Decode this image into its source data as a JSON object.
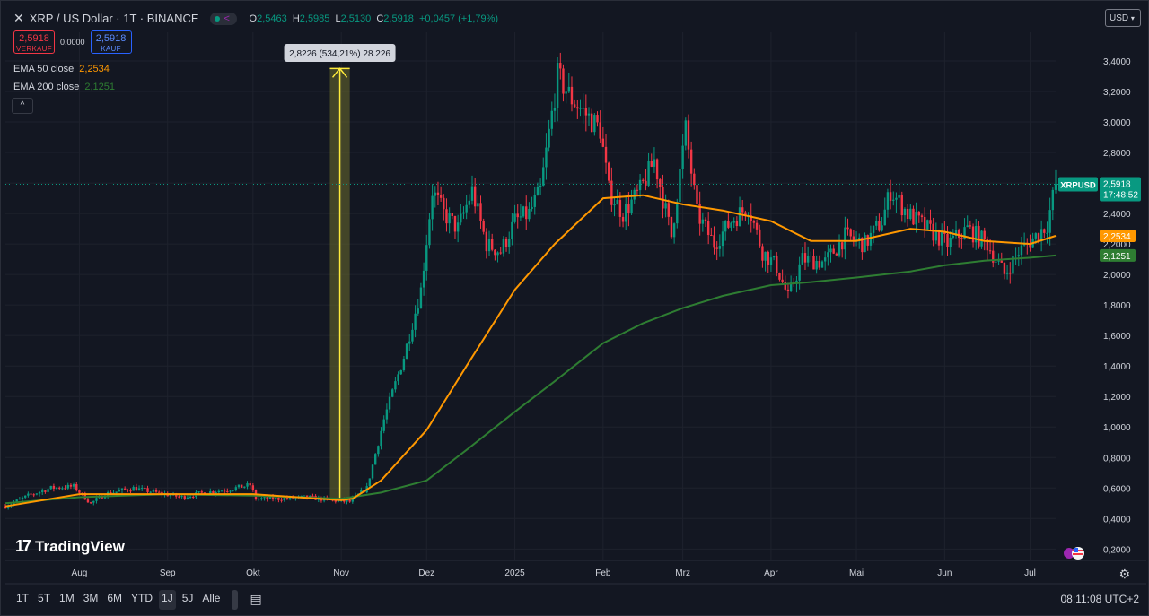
{
  "header": {
    "close_glyph": "✕",
    "title": "XRP / US Dollar · 1T · BINANCE",
    "ohlc": [
      {
        "key": "O",
        "value": "2,5463"
      },
      {
        "key": "H",
        "value": "2,5985"
      },
      {
        "key": "L",
        "value": "2,5130"
      },
      {
        "key": "C",
        "value": "2,5918"
      }
    ],
    "change": "+0,0457 (+1,79%)",
    "status_icons": [
      "live-dot-icon",
      "share-icon"
    ]
  },
  "trade": {
    "sell_price": "2,5918",
    "sell_label": "VERKAUF",
    "spread": "0,0000",
    "buy_price": "2,5918",
    "buy_label": "KAUF"
  },
  "indicators": [
    {
      "label": "EMA 50 close",
      "value": "2,2534",
      "color": "#ff9800"
    },
    {
      "label": "EMA 200 close",
      "value": "2,1251",
      "color": "#2e7d32"
    }
  ],
  "collapse_glyph": "^",
  "currency_button": "USD",
  "logo_text": "TradingView",
  "timeframes": [
    "1T",
    "5T",
    "1M",
    "3M",
    "6M",
    "YTD",
    "1J",
    "5J",
    "Alle"
  ],
  "active_timeframe": "1J",
  "clock": "08:11:08 UTC+2",
  "colors": {
    "up": "#089981",
    "down": "#f23645",
    "ema50": "#ff9800",
    "ema200": "#2e7d32",
    "background": "#131722"
  },
  "chart_data": {
    "type": "candlestick",
    "symbol": "XRPUSD",
    "y_ticks": [
      "3,4000",
      "3,2000",
      "3,0000",
      "2,8000",
      "2,6000",
      "2,4000",
      "2,2000",
      "2,0000",
      "1,8000",
      "1,6000",
      "1,4000",
      "1,2000",
      "1,0000",
      "0,8000",
      "0,6000",
      "0,4000",
      "0,2000"
    ],
    "y_tick_values": [
      3.4,
      3.2,
      3.0,
      2.8,
      2.6,
      2.4,
      2.2,
      2.0,
      1.8,
      1.6,
      1.4,
      1.2,
      1.0,
      0.8,
      0.6,
      0.4,
      0.2
    ],
    "ylim": [
      0.2,
      3.4
    ],
    "x_ticks": [
      "Aug",
      "Sep",
      "Okt",
      "Nov",
      "Dez",
      "2025",
      "Feb",
      "Mrz",
      "Apr",
      "Mai",
      "Jun",
      "Jul"
    ],
    "x_tick_dates": [
      "2024-08-01",
      "2024-09-01",
      "2024-10-01",
      "2024-11-01",
      "2024-12-01",
      "2025-01-01",
      "2025-02-01",
      "2025-03-01",
      "2025-04-01",
      "2025-05-01",
      "2025-06-01",
      "2025-07-01"
    ],
    "last_price": {
      "label": "XRPUSD",
      "value": "2,5918",
      "countdown": "17:48:52",
      "num": 2.5918
    },
    "ema50_tag": {
      "value": "2,2534",
      "num": 2.2534
    },
    "ema200_tag": {
      "value": "2,1251",
      "num": 2.1251
    },
    "range_annotation": {
      "text": "2,8226 (534,21%) 28.226",
      "from_date": "2024-10-28",
      "to_date": "2024-11-04",
      "low": 0.5284,
      "high": 3.351
    },
    "close_series": [
      [
        "2024-07-06",
        0.48
      ],
      [
        "2024-07-14",
        0.55
      ],
      [
        "2024-07-22",
        0.6
      ],
      [
        "2024-07-30",
        0.61
      ],
      [
        "2024-08-05",
        0.5
      ],
      [
        "2024-08-10",
        0.56
      ],
      [
        "2024-08-20",
        0.6
      ],
      [
        "2024-08-28",
        0.57
      ],
      [
        "2024-09-06",
        0.54
      ],
      [
        "2024-09-14",
        0.57
      ],
      [
        "2024-09-22",
        0.59
      ],
      [
        "2024-09-30",
        0.62
      ],
      [
        "2024-10-02",
        0.53
      ],
      [
        "2024-10-10",
        0.53
      ],
      [
        "2024-10-20",
        0.54
      ],
      [
        "2024-10-28",
        0.52
      ],
      [
        "2024-11-04",
        0.51
      ],
      [
        "2024-11-10",
        0.6
      ],
      [
        "2024-11-16",
        1.05
      ],
      [
        "2024-11-23",
        1.46
      ],
      [
        "2024-11-29",
        1.9
      ],
      [
        "2024-12-03",
        2.55
      ],
      [
        "2024-12-07",
        2.4
      ],
      [
        "2024-12-12",
        2.3
      ],
      [
        "2024-12-17",
        2.55
      ],
      [
        "2024-12-22",
        2.2
      ],
      [
        "2024-12-27",
        2.15
      ],
      [
        "2025-01-01",
        2.35
      ],
      [
        "2025-01-06",
        2.4
      ],
      [
        "2025-01-10",
        2.55
      ],
      [
        "2025-01-16",
        3.3
      ],
      [
        "2025-01-21",
        3.15
      ],
      [
        "2025-01-26",
        3.05
      ],
      [
        "2025-01-31",
        2.95
      ],
      [
        "2025-02-03",
        2.55
      ],
      [
        "2025-02-08",
        2.4
      ],
      [
        "2025-02-14",
        2.55
      ],
      [
        "2025-02-19",
        2.75
      ],
      [
        "2025-02-25",
        2.25
      ],
      [
        "2025-03-02",
        2.95
      ],
      [
        "2025-03-06",
        2.4
      ],
      [
        "2025-03-12",
        2.2
      ],
      [
        "2025-03-18",
        2.35
      ],
      [
        "2025-03-24",
        2.45
      ],
      [
        "2025-03-29",
        2.15
      ],
      [
        "2025-04-03",
        2.05
      ],
      [
        "2025-04-07",
        1.85
      ],
      [
        "2025-04-12",
        2.1
      ],
      [
        "2025-04-20",
        2.08
      ],
      [
        "2025-04-27",
        2.25
      ],
      [
        "2025-05-04",
        2.2
      ],
      [
        "2025-05-10",
        2.35
      ],
      [
        "2025-05-13",
        2.55
      ],
      [
        "2025-05-19",
        2.4
      ],
      [
        "2025-05-26",
        2.3
      ],
      [
        "2025-06-02",
        2.2
      ],
      [
        "2025-06-09",
        2.3
      ],
      [
        "2025-06-16",
        2.2
      ],
      [
        "2025-06-22",
        2.0
      ],
      [
        "2025-06-27",
        2.15
      ],
      [
        "2025-07-03",
        2.25
      ],
      [
        "2025-07-07",
        2.33
      ],
      [
        "2025-07-10",
        2.5918
      ]
    ],
    "ema50": [
      [
        "2024-07-06",
        0.48
      ],
      [
        "2024-08-01",
        0.56
      ],
      [
        "2024-09-01",
        0.56
      ],
      [
        "2024-10-01",
        0.56
      ],
      [
        "2024-11-01",
        0.52
      ],
      [
        "2024-11-05",
        0.53
      ],
      [
        "2024-11-15",
        0.65
      ],
      [
        "2024-12-01",
        0.98
      ],
      [
        "2024-12-15",
        1.4
      ],
      [
        "2025-01-01",
        1.9
      ],
      [
        "2025-01-15",
        2.2
      ],
      [
        "2025-02-01",
        2.5
      ],
      [
        "2025-02-15",
        2.52
      ],
      [
        "2025-03-01",
        2.46
      ],
      [
        "2025-03-15",
        2.42
      ],
      [
        "2025-04-01",
        2.35
      ],
      [
        "2025-04-15",
        2.22
      ],
      [
        "2025-05-01",
        2.22
      ],
      [
        "2025-05-20",
        2.3
      ],
      [
        "2025-06-01",
        2.28
      ],
      [
        "2025-06-15",
        2.22
      ],
      [
        "2025-07-01",
        2.2
      ],
      [
        "2025-07-10",
        2.2534
      ]
    ],
    "ema200": [
      [
        "2024-07-06",
        0.5
      ],
      [
        "2024-08-01",
        0.54
      ],
      [
        "2024-09-01",
        0.56
      ],
      [
        "2024-10-01",
        0.55
      ],
      [
        "2024-11-01",
        0.53
      ],
      [
        "2024-11-15",
        0.57
      ],
      [
        "2024-12-01",
        0.65
      ],
      [
        "2024-12-15",
        0.85
      ],
      [
        "2025-01-01",
        1.1
      ],
      [
        "2025-01-15",
        1.3
      ],
      [
        "2025-02-01",
        1.55
      ],
      [
        "2025-02-15",
        1.68
      ],
      [
        "2025-03-01",
        1.78
      ],
      [
        "2025-03-15",
        1.86
      ],
      [
        "2025-04-01",
        1.93
      ],
      [
        "2025-04-15",
        1.95
      ],
      [
        "2025-05-01",
        1.98
      ],
      [
        "2025-05-20",
        2.02
      ],
      [
        "2025-06-01",
        2.06
      ],
      [
        "2025-06-15",
        2.09
      ],
      [
        "2025-07-01",
        2.11
      ],
      [
        "2025-07-10",
        2.1251
      ]
    ]
  }
}
